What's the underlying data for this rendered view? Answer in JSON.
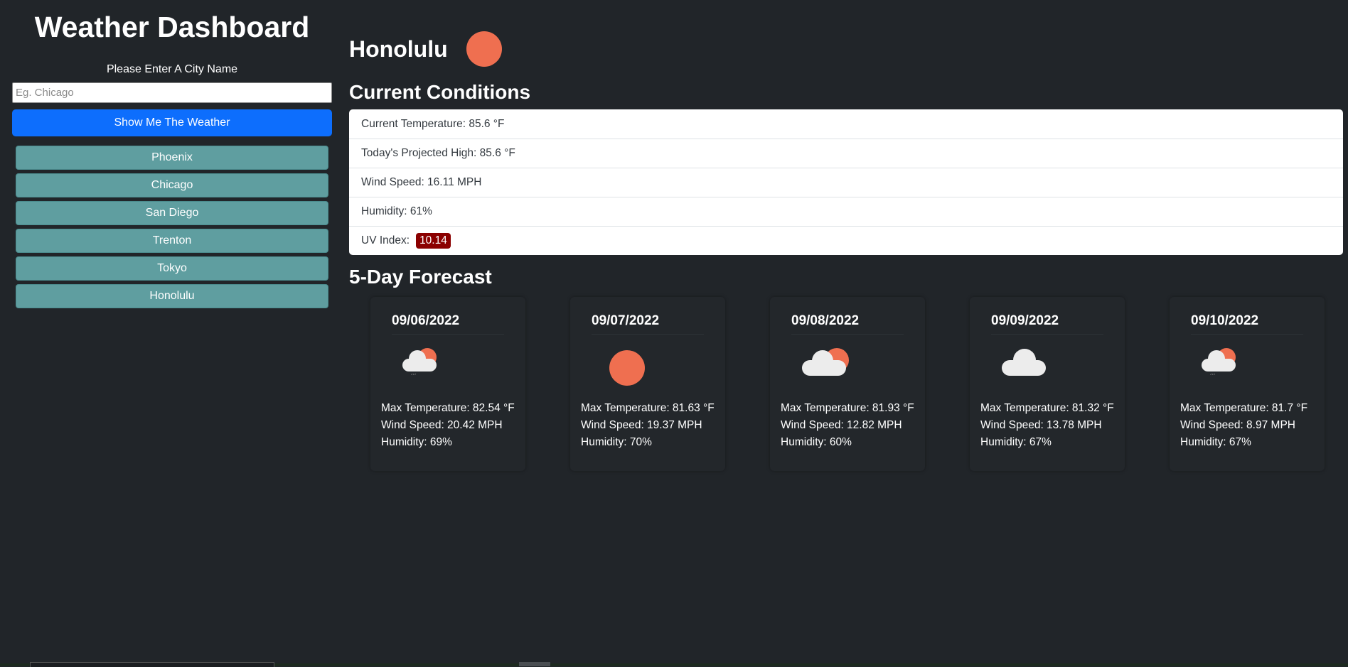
{
  "app": {
    "title": "Weather Dashboard"
  },
  "search": {
    "prompt": "Please Enter A City Name",
    "placeholder": "Eg. Chicago",
    "value": "",
    "button_label": "Show Me The Weather"
  },
  "history": [
    {
      "label": "Phoenix"
    },
    {
      "label": "Chicago"
    },
    {
      "label": "San Diego"
    },
    {
      "label": "Trenton"
    },
    {
      "label": "Tokyo"
    },
    {
      "label": "Honolulu"
    }
  ],
  "current": {
    "city": "Honolulu",
    "icon": "sun-icon",
    "section_title": "Current Conditions",
    "temperature": "Current Temperature: 85.6 °F",
    "high": "Today's Projected High: 85.6 °F",
    "wind": "Wind Speed: 16.11 MPH",
    "humidity": "Humidity: 61%",
    "uv_label": "UV Index:",
    "uv_value": "10.14",
    "uv_color": "#8b0000"
  },
  "forecast": {
    "section_title": "5-Day Forecast",
    "days": [
      {
        "date": "09/06/2022",
        "icon": "rain-cloud-sun-icon",
        "max_temp": "Max Temperature: 82.54 °F",
        "wind": "Wind Speed: 20.42 MPH",
        "humidity": "Humidity: 69%"
      },
      {
        "date": "09/07/2022",
        "icon": "sun-icon",
        "max_temp": "Max Temperature: 81.63 °F",
        "wind": "Wind Speed: 19.37 MPH",
        "humidity": "Humidity: 70%"
      },
      {
        "date": "09/08/2022",
        "icon": "cloud-sun-icon",
        "max_temp": "Max Temperature: 81.93 °F",
        "wind": "Wind Speed: 12.82 MPH",
        "humidity": "Humidity: 60%"
      },
      {
        "date": "09/09/2022",
        "icon": "cloud-icon",
        "max_temp": "Max Temperature: 81.32 °F",
        "wind": "Wind Speed: 13.78 MPH",
        "humidity": "Humidity: 67%"
      },
      {
        "date": "09/10/2022",
        "icon": "rain-cloud-sun-icon",
        "max_temp": "Max Temperature: 81.7 °F",
        "wind": "Wind Speed: 8.97 MPH",
        "humidity": "Humidity: 67%"
      }
    ]
  },
  "colors": {
    "background": "#212529",
    "accent": "#0d6efd",
    "history_button": "#5f9ea0",
    "sun": "#ef6f50"
  }
}
